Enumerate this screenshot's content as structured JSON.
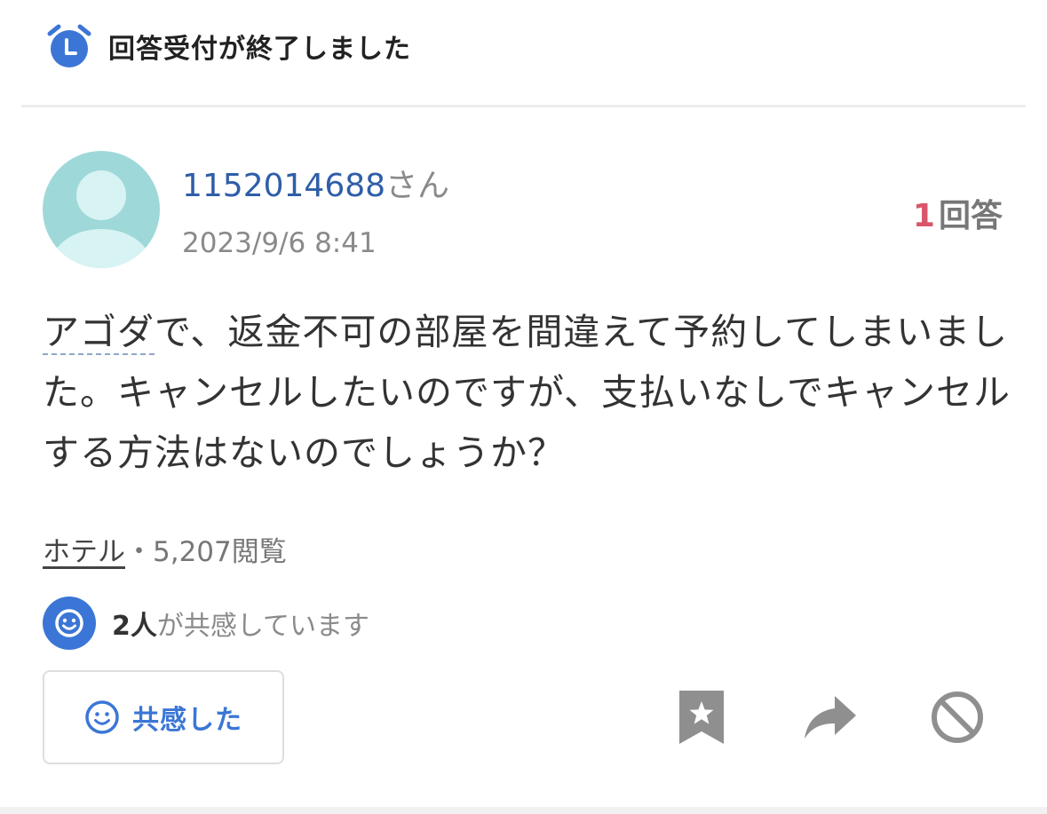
{
  "header": {
    "status_text": "回答受付が終了しました",
    "icon": "alarm-clock-icon"
  },
  "question": {
    "user": {
      "name": "1152014688",
      "suffix": "さん",
      "avatar": "default-avatar"
    },
    "date": "2023/9/6 8:41",
    "answer_count": "1",
    "answer_label": "回答",
    "body_keyword": "アゴダ",
    "body_rest": "で、返金不可の部屋を間違えて予約してしまいました。キャンセルしたいのですが、支払いなしでキャンセルする方法はないのでしょうか？",
    "category": "ホテル",
    "separator": "・",
    "views": "5,207閲覧"
  },
  "empathy": {
    "count": "2人",
    "text": "が共感しています",
    "button_label": "共感した",
    "icon": "smile-icon"
  },
  "actions": {
    "bookmark": "bookmark-star-icon",
    "share": "share-arrow-icon",
    "report": "block-icon"
  },
  "colors": {
    "accent": "#3b76d6",
    "username": "#2f5ea8",
    "answer_count": "#d9566a",
    "avatar": "#9fd8d8"
  }
}
